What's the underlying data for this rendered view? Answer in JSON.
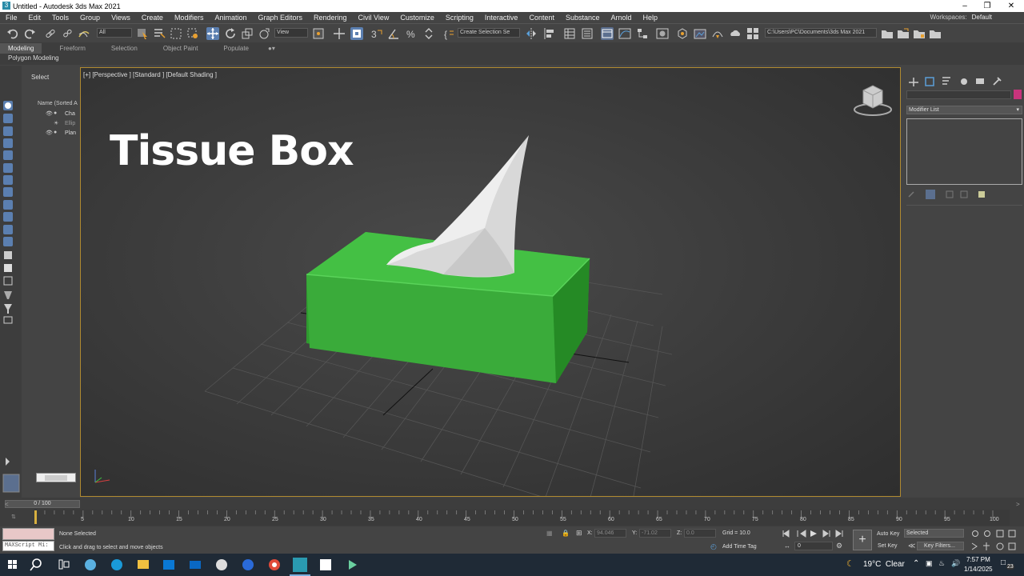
{
  "window": {
    "title": "Untitled - Autodesk 3ds Max 2021",
    "app_icon": "3ds-max-icon"
  },
  "menu": [
    "File",
    "Edit",
    "Tools",
    "Group",
    "Views",
    "Create",
    "Modifiers",
    "Animation",
    "Graph Editors",
    "Rendering",
    "Civil View",
    "Customize",
    "Scripting",
    "Interactive",
    "Content",
    "Substance",
    "Arnold",
    "Help"
  ],
  "workspaces": {
    "label": "Workspaces:",
    "value": "Default"
  },
  "toolbar": {
    "selection_filter": "All",
    "ref_coord": "View",
    "named_selection": "Create Selection Se",
    "project_path": "C:\\Users\\PC\\Documents\\3ds Max 2021"
  },
  "ribbon": {
    "tabs": [
      "Modeling",
      "Freeform",
      "Selection",
      "Object Paint",
      "Populate"
    ],
    "active_tab": "Modeling",
    "subtitle": "Polygon Modeling"
  },
  "scene_explorer": {
    "select_label": "Select",
    "header": "Name (Sorted A",
    "items": [
      "Cha",
      "Ellip",
      "Plan"
    ]
  },
  "viewport": {
    "label": "[+] [Perspective ] [Standard ] [Default Shading ]",
    "overlay_title": "Tissue Box",
    "box_color": "#3fbf3f",
    "tissue_color": "#e4e4e4"
  },
  "command_panel": {
    "modifier_list": "Modifier List",
    "swatch_color": "#c8347c"
  },
  "timeline": {
    "frame_display": "0 / 100",
    "ticks": [
      "5",
      "10",
      "15",
      "20",
      "25",
      "30",
      "35",
      "40",
      "45",
      "50",
      "55",
      "60",
      "65",
      "70",
      "75",
      "80",
      "85",
      "90",
      "95",
      "100"
    ]
  },
  "status": {
    "maxscript": "MAXScript Mi:",
    "selection_status": "None Selected",
    "prompt": "Click and drag to select and move objects",
    "x_label": "X:",
    "x_value": "94.046",
    "y_label": "Y:",
    "y_value": "-71.02",
    "z_label": "Z:",
    "z_value": "0.0",
    "grid": "Grid = 10.0",
    "add_time_tag": "Add Time Tag",
    "auto_key": "Auto Key",
    "set_key": "Set Key",
    "key_mode": "Selected",
    "key_filters": "Key Filters...",
    "frame_field": "0"
  },
  "taskbar": {
    "weather": "19°C  Clear",
    "time": "7:57 PM",
    "date": "1/14/2025",
    "notifications": "23"
  }
}
